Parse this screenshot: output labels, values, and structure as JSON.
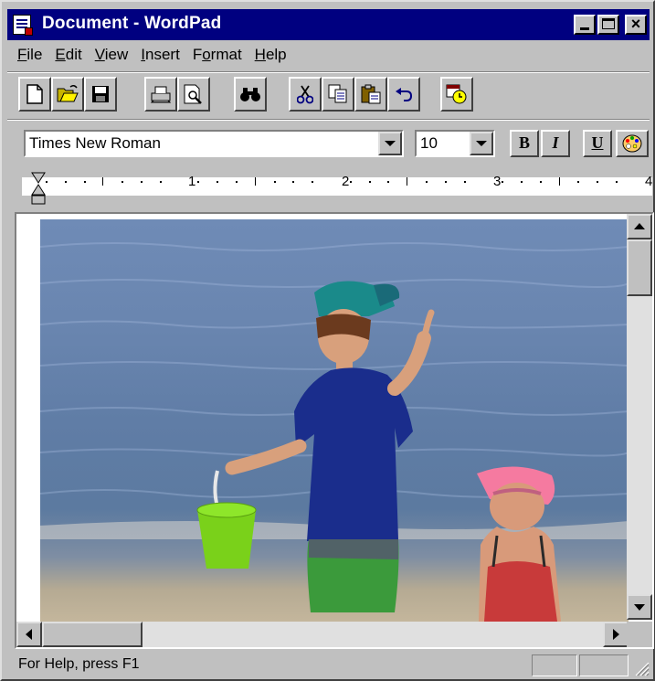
{
  "window": {
    "title": "Document - WordPad",
    "app_icon": "wordpad-document-icon"
  },
  "title_buttons": {
    "close_glyph": "×"
  },
  "menu": [
    {
      "name": "file",
      "accel": "F",
      "rest": "ile"
    },
    {
      "name": "edit",
      "accel": "E",
      "rest": "dit"
    },
    {
      "name": "view",
      "accel": "V",
      "rest": "iew"
    },
    {
      "name": "insert",
      "accel": "I",
      "rest": "nsert"
    },
    {
      "name": "format",
      "pre": "F",
      "accel": "o",
      "rest": "rmat"
    },
    {
      "name": "help",
      "accel": "H",
      "rest": "elp"
    }
  ],
  "toolbar": {
    "buttons": [
      "new-icon",
      "open-icon",
      "save-icon",
      "print-icon",
      "print-preview-icon",
      "find-icon",
      "cut-icon",
      "copy-icon",
      "paste-icon",
      "undo-icon",
      "insert-datetime-icon"
    ]
  },
  "format_bar": {
    "font_name": "Times New Roman",
    "font_size": "10",
    "bold_label": "B",
    "italic_label": "I",
    "underline_label": "U",
    "color_icon": "color-palette-icon"
  },
  "ruler": {
    "numbers": [
      "1",
      "2",
      "3",
      "4"
    ]
  },
  "document": {
    "content": "embedded-photo-children-at-beach"
  },
  "status": {
    "help_text": "For Help, press F1"
  },
  "colors": {
    "titlebar": "#000080",
    "face": "#c0c0c0"
  }
}
